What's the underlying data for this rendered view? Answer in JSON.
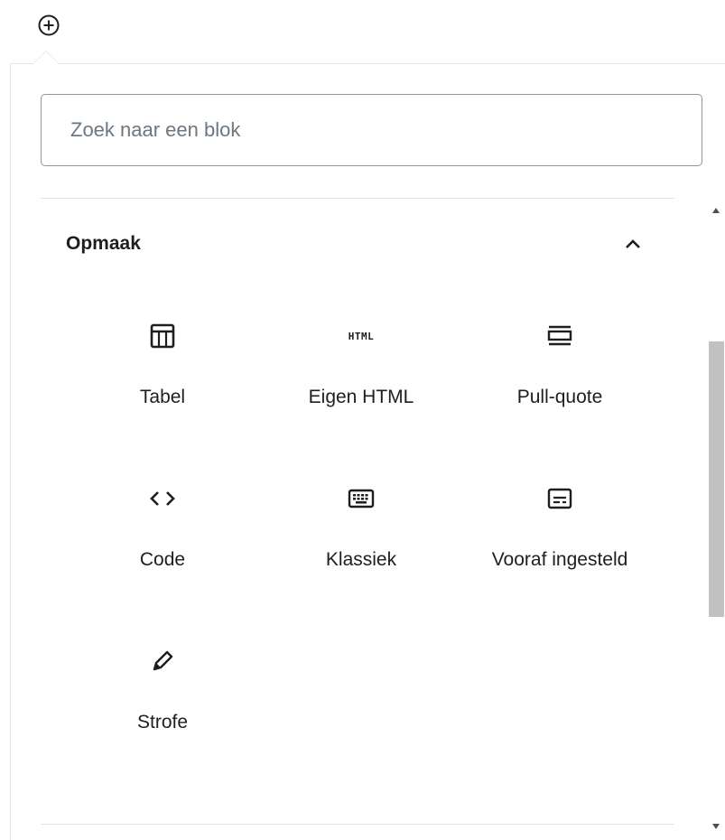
{
  "inserter": {
    "toggle_icon": "plus-circle-icon",
    "search": {
      "placeholder": "Zoek naar een blok",
      "value": ""
    },
    "section": {
      "title": "Opmaak",
      "expanded": true,
      "toggle_icon": "chevron-up-icon"
    },
    "blocks": [
      {
        "label": "Tabel",
        "icon": "table-icon"
      },
      {
        "label": "Eigen HTML",
        "icon": "html-icon",
        "icon_text": "HTML"
      },
      {
        "label": "Pull-quote",
        "icon": "pullquote-icon"
      },
      {
        "label": "Code",
        "icon": "code-icon"
      },
      {
        "label": "Klassiek",
        "icon": "keyboard-icon"
      },
      {
        "label": "Vooraf ingesteld",
        "icon": "preformatted-icon"
      },
      {
        "label": "Strofe",
        "icon": "pencil-icon"
      }
    ]
  },
  "colors": {
    "text": "#1e1e1e",
    "border": "#8d96a0",
    "divider": "#e2e4e7",
    "scrollbar_thumb": "#c1c1c1"
  }
}
